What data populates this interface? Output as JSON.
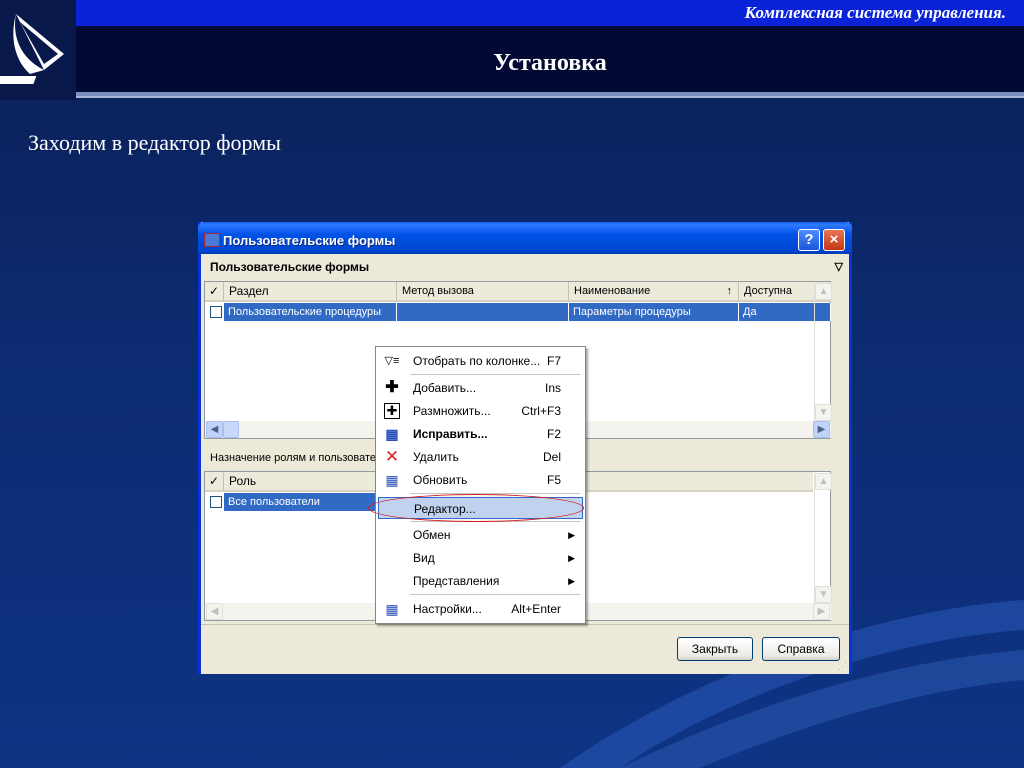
{
  "slide": {
    "brand": "Комплексная система управления.",
    "title": "Установка",
    "subtitle": "Заходим в редактор формы"
  },
  "window": {
    "title": "Пользовательские формы",
    "help_glyph": "?",
    "close_glyph": "×"
  },
  "top_panel": {
    "header": "Пользовательские формы",
    "columns": [
      "Раздел",
      "Метод вызова",
      "Наименование",
      "Доступна"
    ],
    "check_header": "✓",
    "rows": [
      {
        "section": "Пользовательские процедуры",
        "method": "",
        "name": "Параметры процедуры",
        "available": "Да"
      }
    ]
  },
  "bottom_panel": {
    "header": "Назначение ролям и пользователям",
    "columns": [
      "Роль"
    ],
    "check_header": "✓",
    "rows": [
      {
        "role": "Все пользователи"
      }
    ]
  },
  "context_menu": {
    "items": [
      {
        "label": "Отобрать по колонке...",
        "key": "F7",
        "icon": "filter-icon"
      },
      {
        "label": "Добавить...",
        "key": "Ins",
        "icon": "plus-icon"
      },
      {
        "label": "Размножить...",
        "key": "Ctrl+F3",
        "icon": "duplicate-icon"
      },
      {
        "label": "Исправить...",
        "key": "F2",
        "icon": "edit-icon"
      },
      {
        "label": "Удалить",
        "key": "Del",
        "icon": "delete-icon"
      },
      {
        "label": "Обновить",
        "key": "F5",
        "icon": "refresh-icon"
      },
      {
        "label": "Редактор...",
        "key": "",
        "icon": ""
      },
      {
        "label": "Обмен",
        "key": "",
        "icon": ""
      },
      {
        "label": "Вид",
        "key": "",
        "icon": ""
      },
      {
        "label": "Представления",
        "key": "",
        "icon": ""
      },
      {
        "label": "Настройки...",
        "key": "Alt+Enter",
        "icon": "settings-icon"
      }
    ]
  },
  "footer": {
    "close_label": "Закрыть",
    "help_label": "Справка"
  },
  "colors": {
    "selection": "#316ac5",
    "title_bar": "#0052e6",
    "highlight_ellipse": "#d81e1e"
  }
}
